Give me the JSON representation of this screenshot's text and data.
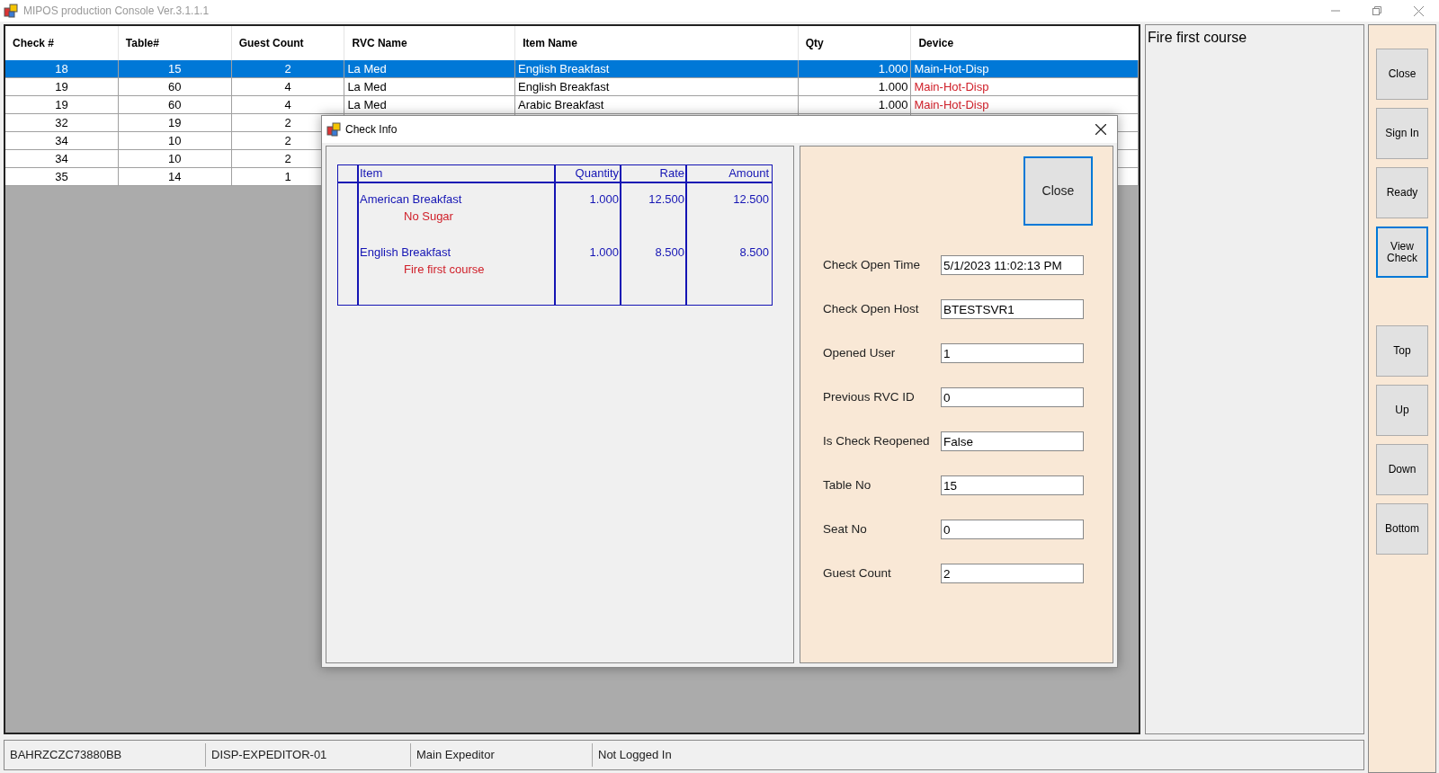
{
  "window": {
    "title": "MIPOS production Console Ver.3.1.1.1"
  },
  "table": {
    "columns": [
      "Check #",
      "Table#",
      "Guest Count",
      "RVC Name",
      "Item Name",
      "Qty",
      "Device"
    ],
    "rows": [
      {
        "cells": [
          "18",
          "15",
          "2",
          "La Med",
          "English Breakfast",
          "1.000",
          "Main-Hot-Disp"
        ],
        "selected": true,
        "device_alert": false
      },
      {
        "cells": [
          "19",
          "60",
          "4",
          "La Med",
          "English Breakfast",
          "1.000",
          "Main-Hot-Disp"
        ],
        "selected": false,
        "device_alert": true
      },
      {
        "cells": [
          "19",
          "60",
          "4",
          "La Med",
          "Arabic Breakfast",
          "1.000",
          "Main-Hot-Disp"
        ],
        "selected": false,
        "device_alert": true
      },
      {
        "cells": [
          "32",
          "19",
          "2"
        ],
        "selected": false
      },
      {
        "cells": [
          "34",
          "10",
          "2"
        ],
        "selected": false
      },
      {
        "cells": [
          "34",
          "10",
          "2"
        ],
        "selected": false
      },
      {
        "cells": [
          "35",
          "14",
          "1"
        ],
        "selected": false
      }
    ]
  },
  "note": "Fire first course",
  "side_buttons": {
    "upper": [
      {
        "label": "Close",
        "focused": false
      },
      {
        "label": "Sign In",
        "focused": false
      },
      {
        "label": "Ready",
        "focused": false
      },
      {
        "label": "View Check",
        "focused": true
      }
    ],
    "lower": [
      {
        "label": "Top",
        "focused": false
      },
      {
        "label": "Up",
        "focused": false
      },
      {
        "label": "Down",
        "focused": false
      },
      {
        "label": "Bottom",
        "focused": false
      }
    ]
  },
  "dialog": {
    "title": "Check Info",
    "columns": [
      "Item",
      "Quantity",
      "Rate",
      "Amount"
    ],
    "items": [
      {
        "name": "American Breakfast",
        "modifier": "No Sugar",
        "quantity": "1.000",
        "rate": "12.500",
        "amount": "12.500"
      },
      {
        "name": "English Breakfast",
        "modifier": "Fire first course",
        "quantity": "1.000",
        "rate": "8.500",
        "amount": "8.500"
      }
    ],
    "close_button": {
      "label": "Close",
      "focused": true
    },
    "fields": [
      {
        "label": "Check Open Time",
        "value": "5/1/2023 11:02:13 PM"
      },
      {
        "label": "Check Open Host",
        "value": "BTESTSVR1"
      },
      {
        "label": "Opened User",
        "value": "1"
      },
      {
        "label": "Previous RVC ID",
        "value": "0"
      },
      {
        "label": "Is Check Reopened",
        "value": "False"
      },
      {
        "label": "Table No",
        "value": "15"
      },
      {
        "label": "Seat No",
        "value": "0"
      },
      {
        "label": "Guest Count",
        "value": "2"
      }
    ]
  },
  "status_bar": [
    "BAHRZCZC73880BB",
    "DISP-EXPEDITOR-01",
    "Main Expeditor",
    "Not Logged In"
  ]
}
